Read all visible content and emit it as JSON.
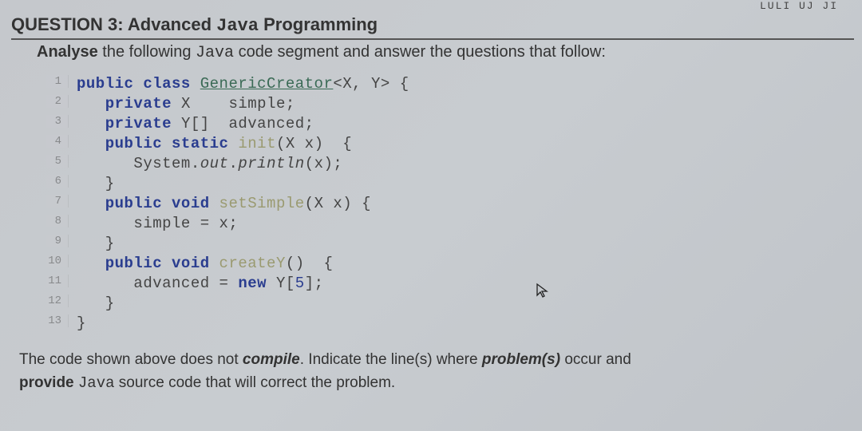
{
  "header": {
    "date_fragment": "LULI UJ JI"
  },
  "question": {
    "label": "QUESTION 3:",
    "title": "Advanced",
    "title_mono": "Java",
    "title_tail": "Programming"
  },
  "instruction": {
    "verb": "Analyse",
    "pre": "the following",
    "mono": "Java",
    "post": "code segment and answer the questions that follow:"
  },
  "code": {
    "lines": [
      {
        "n": "1",
        "txt_parts": [
          [
            "kw",
            "public class "
          ],
          [
            "cls",
            "GenericCreator"
          ],
          [
            "typ",
            "<X, Y>"
          ],
          [
            "",
            " {"
          ]
        ]
      },
      {
        "n": "2",
        "txt_parts": [
          [
            "",
            "   "
          ],
          [
            "kw",
            "private"
          ],
          [
            "",
            " X    simple;"
          ]
        ]
      },
      {
        "n": "3",
        "txt_parts": [
          [
            "",
            "   "
          ],
          [
            "kw",
            "private"
          ],
          [
            "",
            " Y[]  advanced;"
          ]
        ]
      },
      {
        "n": "4",
        "txt_parts": [
          [
            "",
            "   "
          ],
          [
            "kw",
            "public static"
          ],
          [
            "",
            " "
          ],
          [
            "method-new",
            "init"
          ],
          [
            "",
            "(X x)  {"
          ]
        ]
      },
      {
        "n": "5",
        "txt_parts": [
          [
            "",
            "      System."
          ],
          [
            "method-known",
            "out"
          ],
          [
            "",
            "."
          ],
          [
            "method-known",
            "println"
          ],
          [
            "",
            "(x);"
          ]
        ]
      },
      {
        "n": "6",
        "txt_parts": [
          [
            "",
            "   }"
          ]
        ]
      },
      {
        "n": "7",
        "txt_parts": [
          [
            "",
            "   "
          ],
          [
            "kw",
            "public void"
          ],
          [
            "",
            " "
          ],
          [
            "method-new",
            "setSimple"
          ],
          [
            "",
            "(X x) {"
          ]
        ]
      },
      {
        "n": "8",
        "txt_parts": [
          [
            "",
            "      simple = x;"
          ]
        ]
      },
      {
        "n": "9",
        "txt_parts": [
          [
            "",
            "   }"
          ]
        ]
      },
      {
        "n": "10",
        "txt_parts": [
          [
            "",
            "   "
          ],
          [
            "kw",
            "public void"
          ],
          [
            "",
            " "
          ],
          [
            "method-new",
            "createY"
          ],
          [
            "",
            "()  {"
          ]
        ]
      },
      {
        "n": "11",
        "txt_parts": [
          [
            "",
            "      advanced = "
          ],
          [
            "highlight-new",
            "new"
          ],
          [
            "",
            " Y["
          ],
          [
            "num",
            "5"
          ],
          [
            "",
            "];"
          ]
        ]
      },
      {
        "n": "12",
        "txt_parts": [
          [
            "",
            "   }"
          ]
        ]
      },
      {
        "n": "13",
        "txt_parts": [
          [
            "",
            "}"
          ]
        ]
      }
    ]
  },
  "footer": {
    "p1a": "The code shown above does not ",
    "p1b": "compile",
    "p1c": ".  Indicate the line(s) where ",
    "p1d": "problem(s)",
    "p1e": " occur and",
    "p2a": "provide",
    "p2b": "Java",
    "p2c": "source code that will correct the problem."
  },
  "cursor_glyph": "↖"
}
